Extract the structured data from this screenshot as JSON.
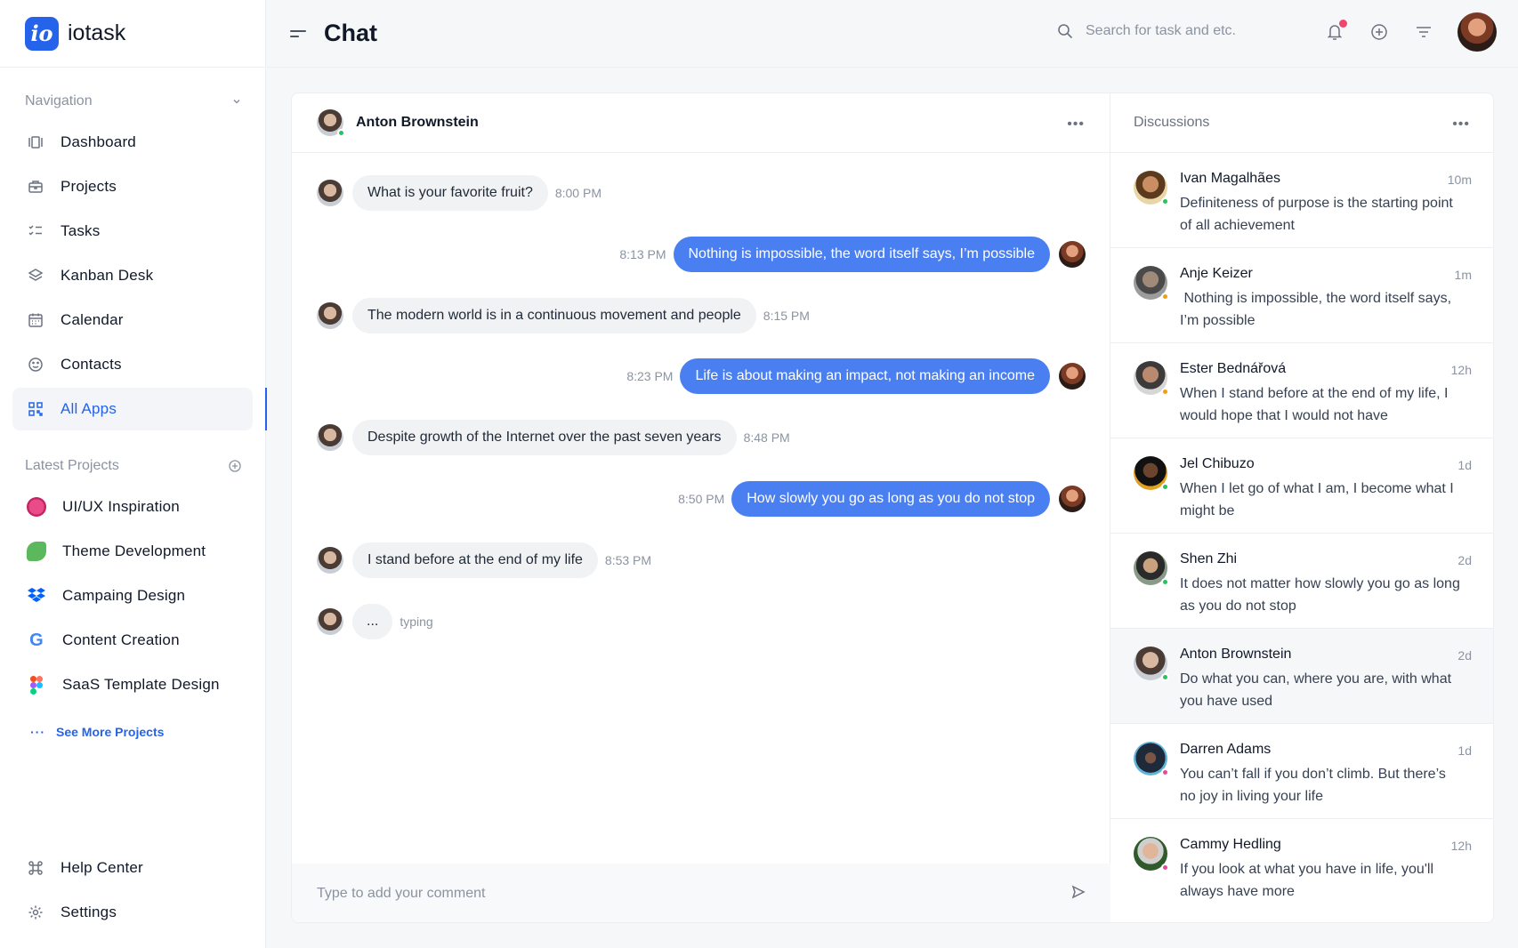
{
  "app": {
    "name": "iotask",
    "logo_text": "io"
  },
  "sidebar": {
    "navigation_label": "Navigation",
    "nav_items": [
      {
        "label": "Dashboard",
        "icon": "dashboard-icon"
      },
      {
        "label": "Projects",
        "icon": "briefcase-icon"
      },
      {
        "label": "Tasks",
        "icon": "checklist-icon"
      },
      {
        "label": "Kanban Desk",
        "icon": "layers-icon"
      },
      {
        "label": "Calendar",
        "icon": "calendar-icon"
      },
      {
        "label": "Contacts",
        "icon": "smiley-icon"
      },
      {
        "label": "All Apps",
        "icon": "apps-grid-icon",
        "active": true
      }
    ],
    "projects_label": "Latest Projects",
    "projects": [
      {
        "label": "UI/UX Inspiration",
        "icon": "dribbble-icon",
        "color": "#ea4c89"
      },
      {
        "label": "Theme Development",
        "icon": "leaf-icon",
        "color": "#5cb85c"
      },
      {
        "label": "Campaing Design",
        "icon": "dropbox-icon",
        "color": "#0061fe"
      },
      {
        "label": "Content Creation",
        "icon": "google-icon",
        "color": "#4285f4"
      },
      {
        "label": "SaaS Template Design",
        "icon": "figma-icon",
        "color": "#f24e1e"
      }
    ],
    "see_more": "See More Projects",
    "footer": [
      {
        "label": "Help Center",
        "icon": "command-icon"
      },
      {
        "label": "Settings",
        "icon": "gear-icon"
      }
    ]
  },
  "header": {
    "title": "Chat",
    "search_placeholder": "Search for task and etc."
  },
  "chat": {
    "contact_name": "Anton Brownstein",
    "messages": [
      {
        "dir": "in",
        "text": "What is your favorite fruit?",
        "time": "8:00 PM"
      },
      {
        "dir": "out",
        "text": "Nothing is impossible, the word itself says, I’m possible",
        "time": "8:13 PM"
      },
      {
        "dir": "in",
        "text": "The modern world is in a continuous movement and people",
        "time": "8:15 PM"
      },
      {
        "dir": "out",
        "text": "Life is about making an impact, not making an income",
        "time": "8:23 PM"
      },
      {
        "dir": "in",
        "text": "Despite growth of the Internet over the past seven years",
        "time": "8:48 PM"
      },
      {
        "dir": "out",
        "text": "How slowly you go as long as you do not stop",
        "time": "8:50 PM"
      },
      {
        "dir": "in",
        "text": "I stand before at the end of my life",
        "time": "8:53 PM"
      }
    ],
    "typing_bubble": "...",
    "typing_label": "typing",
    "composer_placeholder": "Type to add your comment"
  },
  "discussions": {
    "title": "Discussions",
    "items": [
      {
        "name": "Ivan Magalhães",
        "time": "10m",
        "text": "Definiteness of purpose is the starting point of all achievement",
        "status": "green"
      },
      {
        "name": "Anje Keizer",
        "time": "1m",
        "text": " Nothing is impossible, the word itself says, I’m possible",
        "status": "orange"
      },
      {
        "name": "Ester Bednářová",
        "time": "12h",
        "text": "When I stand before at the end of my life, I would hope that I would not have",
        "status": "orange"
      },
      {
        "name": "Jel Chibuzo",
        "time": "1d",
        "text": "When I let go of what I am, I become what I might be",
        "status": "green"
      },
      {
        "name": "Shen Zhi",
        "time": "2d",
        "text": "It does not matter how slowly you go as long as you do not stop",
        "status": "green"
      },
      {
        "name": "Anton Brownstein",
        "time": "2d",
        "text": "Do what you can, where you are, with what you have used",
        "status": "green",
        "active": true
      },
      {
        "name": "Darren Adams",
        "time": "1d",
        "text": "You can’t fall if you don’t climb. But there’s no joy in living your life",
        "status": "pink"
      },
      {
        "name": "Cammy Hedling",
        "time": "12h",
        "text": "If you look at what you have in life, you'll always have more",
        "status": "pink"
      }
    ]
  },
  "colors": {
    "accent": "#2563eb",
    "bubble_out": "#4a7ff1",
    "notification": "#ef476f"
  }
}
